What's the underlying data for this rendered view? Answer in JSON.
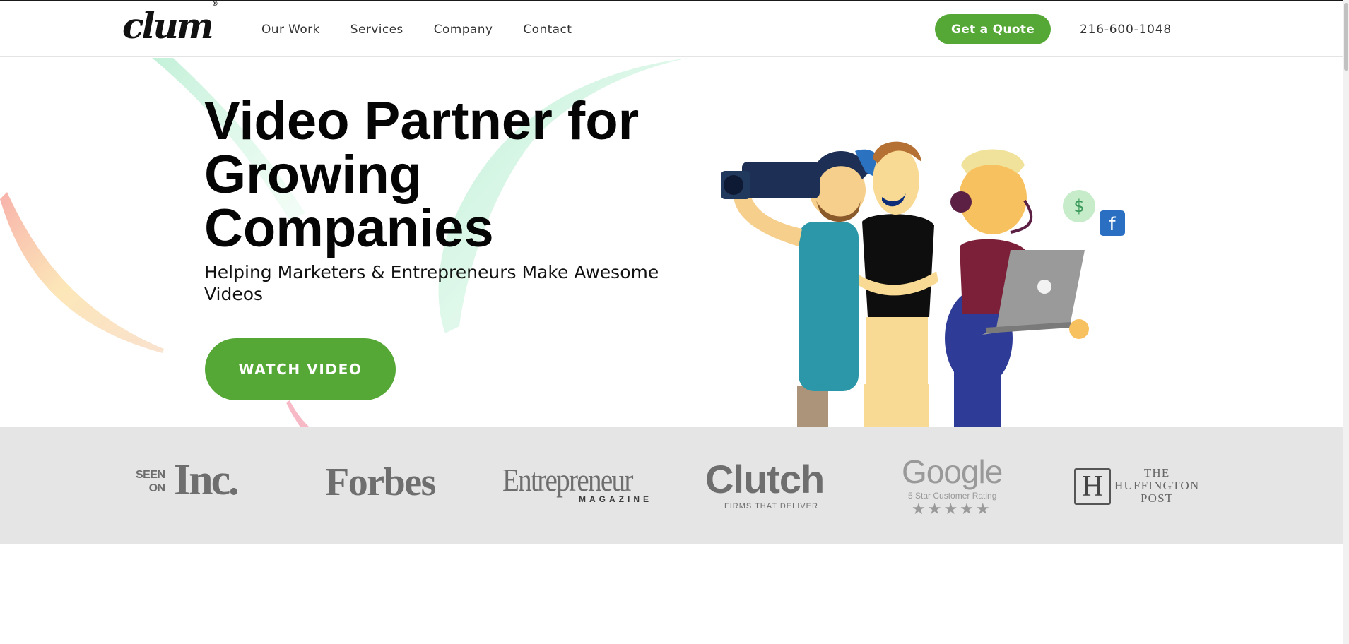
{
  "header": {
    "logo_text": "clum",
    "logo_mark": "®",
    "nav": [
      "Our Work",
      "Services",
      "Company",
      "Contact"
    ],
    "cta_label": "Get a Quote",
    "phone": "216-600-1048"
  },
  "hero": {
    "title_lines": [
      "Video Partner for",
      "Growing",
      "Companies"
    ],
    "subtitle": "Helping Marketers & Entrepreneurs Make Awesome Videos",
    "button_label": "WATCH VIDEO"
  },
  "press": {
    "inc_seen_line1": "SEEN",
    "inc_seen_line2": "ON",
    "inc": "Inc.",
    "forbes": "Forbes",
    "entrepreneur": "Entrepreneur",
    "entrepreneur_sub": "MAGAZINE",
    "clutch": "Clutch",
    "clutch_tag": "FIRMS THAT DELIVER",
    "google": "Google",
    "google_tag": "5 Star Customer Rating",
    "google_stars": "★★★★★",
    "huffington_mark": "H",
    "huffington_line1": "THE",
    "huffington_line2": "HUFFINGTON",
    "huffington_line3": "POST"
  },
  "colors": {
    "accent_green": "#56a836",
    "strip_gray": "#e5e5e5"
  },
  "icons": {
    "dollar": "dollar-icon",
    "facebook": "facebook-icon"
  }
}
